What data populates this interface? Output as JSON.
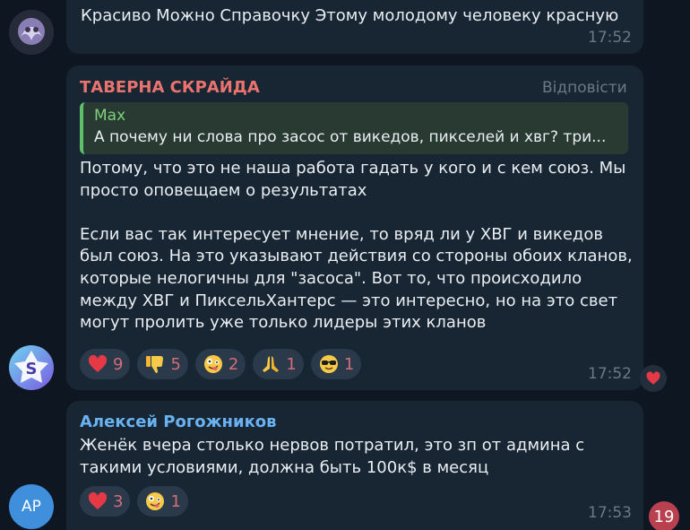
{
  "messages": [
    {
      "text": "Красиво Можно Справочку Этому молодому человеку красную",
      "time": "17:52"
    },
    {
      "sender": "ТАВЕРНА СКРАЙДА",
      "sender_color": "#e9746f",
      "reply_label": "Відповісти",
      "quote": {
        "name": "Max",
        "text": "А почему ни слова про засос от викедов, пикселей и хвг? три..."
      },
      "text": "Потому, что это не наша работа гадать у кого и с кем союз. Мы просто оповещаем о результатах\n\nЕсли вас так интересует мнение, то вряд ли у ХВГ и викедов был союз. На это указывают действия со стороны обоих кланов, которые нелогичны для \"засоса\". Вот то, что происходило между ХВГ и ПиксельХантерс — это интересно, но на это свет могут пролить уже только лидеры этих кланов",
      "reactions": [
        {
          "emoji": "red-heart-emoji",
          "count": "9"
        },
        {
          "emoji": "thumbs-down-emoji",
          "count": "5"
        },
        {
          "emoji": "zany-face-emoji",
          "count": "2"
        },
        {
          "emoji": "folded-hands-emoji",
          "count": "1"
        },
        {
          "emoji": "sunglasses-face-emoji",
          "count": "1"
        }
      ],
      "time": "17:52"
    },
    {
      "sender": "Алексей Рогожников",
      "sender_color": "#6ab3f3",
      "avatar_initials": "АР",
      "text": "Женёк вчера столько нервов потратил, это зп от админа с такими условиями, должна быть 100к$ в месяц",
      "reactions": [
        {
          "emoji": "red-heart-emoji",
          "count": "3"
        },
        {
          "emoji": "zany-face-emoji",
          "count": "1"
        }
      ],
      "time": "17:53"
    }
  ],
  "unread_count": "19",
  "colors": {
    "background": "#0e1621",
    "bubble": "#182533",
    "accent_red": "#b9404f"
  }
}
